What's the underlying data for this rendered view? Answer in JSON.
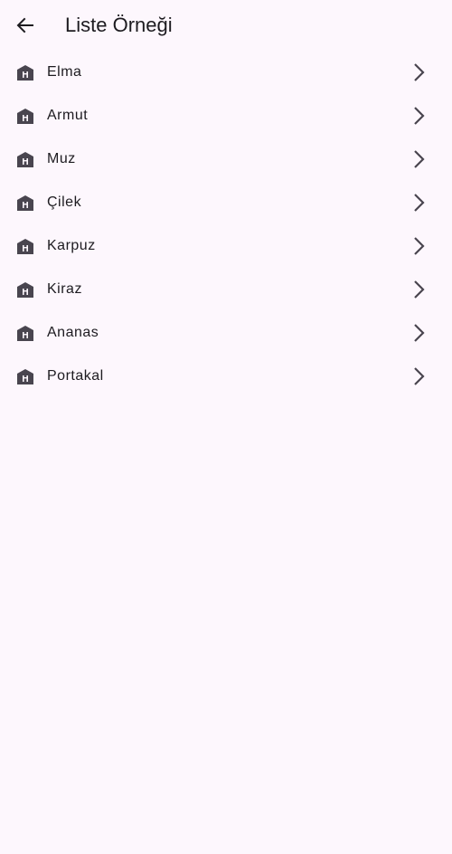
{
  "app_bar": {
    "title": "Liste Örneği",
    "back_icon": "arrow-back-icon"
  },
  "list": {
    "leading_icon": "store-icon",
    "trailing_icon": "chevron-right-icon",
    "items": [
      {
        "label": "Elma"
      },
      {
        "label": "Armut"
      },
      {
        "label": "Muz"
      },
      {
        "label": "Çilek"
      },
      {
        "label": "Karpuz"
      },
      {
        "label": "Kiraz"
      },
      {
        "label": "Ananas"
      },
      {
        "label": "Portakal"
      }
    ]
  },
  "colors": {
    "background": "#fdf7fd",
    "text": "#1d1b20",
    "icon": "#49454f"
  }
}
